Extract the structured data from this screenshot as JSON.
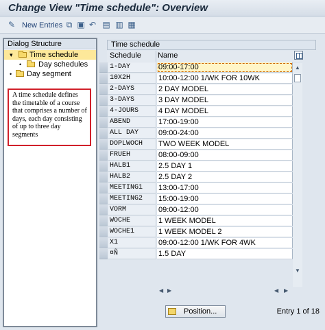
{
  "window": {
    "title": "Change View \"Time schedule\": Overview"
  },
  "toolbar": {
    "new_entries_label": "New Entries",
    "icons": [
      "edit-icon",
      "copy-icon",
      "delete-icon",
      "undo-icon",
      "select-all-icon",
      "select-block-icon",
      "deselect-all-icon"
    ]
  },
  "dialog_structure": {
    "header": "Dialog Structure",
    "items": [
      {
        "label": "Time schedule",
        "selected": true
      },
      {
        "label": "Day schedules",
        "selected": false
      },
      {
        "label": "Day segment",
        "selected": false
      }
    ]
  },
  "annotation": {
    "text": "A time schedule defines the timetable of a course that comprises a number of days, each day consisting of up to three day segments",
    "color": "#d1202a"
  },
  "table": {
    "title": "Time schedule",
    "columns": [
      "Schedule",
      "Name"
    ],
    "rows": [
      {
        "schedule": "1-DAY",
        "name": "09:00-17:00"
      },
      {
        "schedule": "10X2H",
        "name": "10:00-12:00 1/WK FOR 10WK"
      },
      {
        "schedule": "2-DAYS",
        "name": "2 DAY MODEL"
      },
      {
        "schedule": "3-DAYS",
        "name": "3 DAY MODEL"
      },
      {
        "schedule": "4-JOURS",
        "name": "4 DAY MODEL"
      },
      {
        "schedule": "ABEND",
        "name": "17:00-19:00"
      },
      {
        "schedule": "ALL DAY",
        "name": "09:00-24:00"
      },
      {
        "schedule": "DOPLWOCH",
        "name": "TWO WEEK MODEL"
      },
      {
        "schedule": "FRUEH",
        "name": "08:00-09:00"
      },
      {
        "schedule": "HALB1",
        "name": "2.5 DAY 1"
      },
      {
        "schedule": "HALB2",
        "name": "2.5 DAY 2"
      },
      {
        "schedule": "MEETING1",
        "name": "13:00-17:00"
      },
      {
        "schedule": "MEETING2",
        "name": "15:00-19:00"
      },
      {
        "schedule": "VORM",
        "name": "09:00-12:00"
      },
      {
        "schedule": "WOCHE",
        "name": "1 WEEK MODEL"
      },
      {
        "schedule": "WOCHE1",
        "name": "1 WEEK MODEL 2"
      },
      {
        "schedule": "X1",
        "name": "09:00-12:00 1/WK FOR 4WK"
      },
      {
        "schedule": "¤Ñ",
        "name": "1.5 DAY"
      }
    ]
  },
  "footer": {
    "position_label": "Position...",
    "entry_label": "Entry 1 of 18"
  }
}
